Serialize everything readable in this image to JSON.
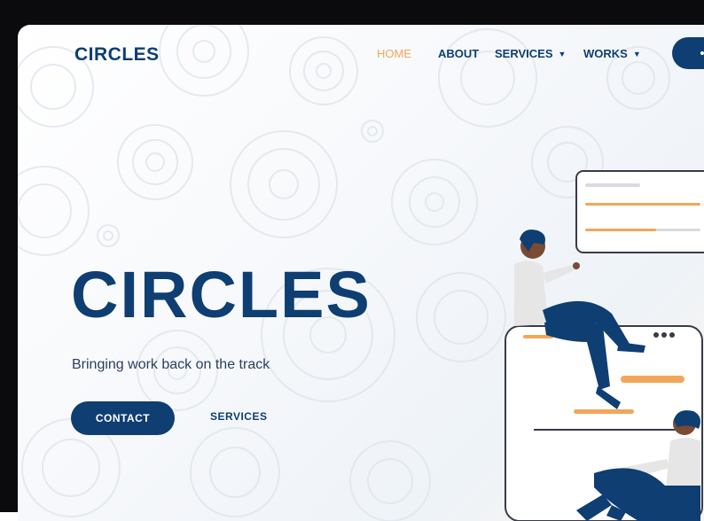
{
  "brand": {
    "logo_text": "CIRCLES"
  },
  "nav": {
    "items": [
      {
        "label": "HOME",
        "active": true,
        "dropdown": false
      },
      {
        "label": "ABOUT",
        "active": false,
        "dropdown": false
      },
      {
        "label": "SERVICES",
        "active": false,
        "dropdown": true
      },
      {
        "label": "WORKS",
        "active": false,
        "dropdown": true
      }
    ],
    "caret_icon": "caret-down-icon"
  },
  "hero": {
    "title": "CIRCLES",
    "subtitle": "Bringing work back on the track",
    "contact_label": "CONTACT",
    "services_label": "SERVICES"
  },
  "colors": {
    "primary": "#0e3e72",
    "accent": "#f2a65a",
    "bezel": "#0b0b0d",
    "text_muted": "#2b3f5e"
  }
}
